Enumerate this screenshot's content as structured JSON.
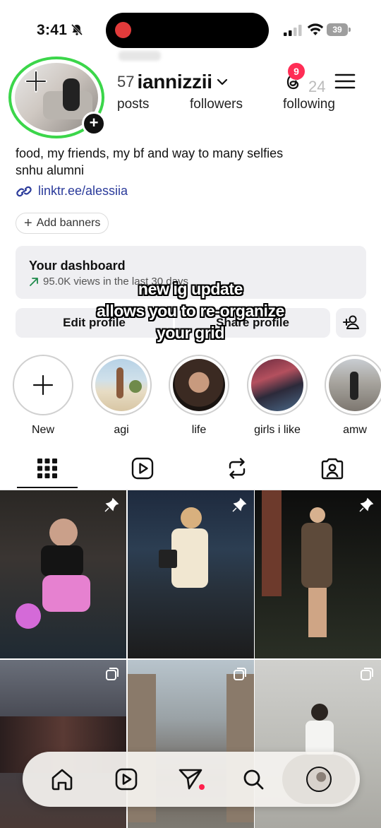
{
  "status_bar": {
    "time": "3:41",
    "battery": "39",
    "icons": [
      "bell-slash-icon",
      "cellular-signal-icon",
      "wifi-icon",
      "battery-icon"
    ]
  },
  "profile": {
    "username": "iannizzii",
    "posts_count": "57",
    "posts_label": "posts",
    "followers_label": "followers",
    "following_count_partial": "24",
    "following_label": "following",
    "notification_count": "9",
    "bio_line_1": "food, my friends, my bf and way to many selfies",
    "bio_line_2": "snhu alumni",
    "link": "linktr.ee/alessiia",
    "add_banners": "Add banners"
  },
  "dashboard": {
    "title": "Your dashboard",
    "subtitle": "95.0K views in the last 30 days"
  },
  "actions": {
    "edit_profile": "Edit profile",
    "share_profile": "Share profile"
  },
  "overlay_caption": {
    "line_1": "new ig update",
    "line_2": "allows you to re-organize",
    "line_3": "your grid"
  },
  "highlights": [
    {
      "label": "New"
    },
    {
      "label": "agi"
    },
    {
      "label": "life"
    },
    {
      "label": "girls i like"
    },
    {
      "label": "amw"
    }
  ],
  "tabs": [
    "grid-icon",
    "reels-icon",
    "reposts-icon",
    "tagged-icon"
  ],
  "bottom_nav": [
    "home-icon",
    "reels-icon",
    "direct-messages-icon",
    "search-icon",
    "profile-avatar"
  ],
  "colors": {
    "story_ring": "#3bd64a",
    "badge": "#ff2d55",
    "link": "#2a3a9a",
    "button_bg": "#efeff2"
  }
}
